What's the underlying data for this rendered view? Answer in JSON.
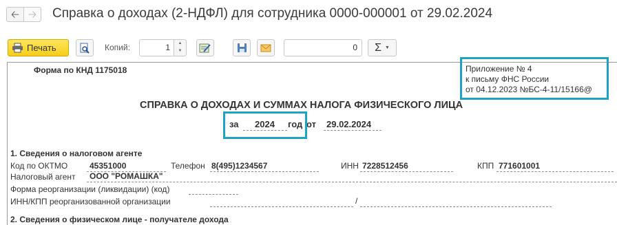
{
  "window": {
    "title": "Справка о доходах (2-НДФЛ) для сотрудника 0000-000001 от 29.02.2024",
    "back_icon": "arrow-left-icon",
    "forward_icon": "arrow-right-icon"
  },
  "toolbar": {
    "print_label": "Печать",
    "copies_label": "Копий:",
    "copies_value": "1",
    "sum_value": "0",
    "sigma_label": "Σ"
  },
  "document": {
    "form_code": "Форма по КНД 1175018",
    "appendix": {
      "line1": "Приложение № 4",
      "line2": "к письму ФНС России",
      "line3": "от 04.12.2023 №БС-4-11/15166@"
    },
    "heading": "СПРАВКА О ДОХОДАХ И СУММАХ НАЛОГА ФИЗИЧЕСКОГО ЛИЦА",
    "period": {
      "prefix": "за",
      "year": "2024",
      "year_suffix": "год",
      "from_label": "от",
      "date": "29.02.2024"
    },
    "section1": {
      "title": "1. Сведения о налоговом агенте",
      "oktmo_label": "Код по ОКТМО",
      "oktmo_value": "45351000",
      "phone_label": "Телефон",
      "phone_value": "8(495)1234567",
      "inn_label": "ИНН",
      "inn_value": "7228512456",
      "kpp_label": "КПП",
      "kpp_value": "771601001",
      "agent_label": "Налоговый агент",
      "agent_value": "ООО \"РОМАШКА\"",
      "reorg_label": "Форма реорганизации (ликвидации)  (код)",
      "reorg_inn_label": "ИНН/КПП  реорганизованной организации",
      "slash": "/"
    },
    "section2": {
      "title": "2. Сведения о физическом лице - получателе дохода"
    }
  },
  "colors": {
    "highlight": "#1fa3c5",
    "print_button": "#f6cf1b"
  }
}
